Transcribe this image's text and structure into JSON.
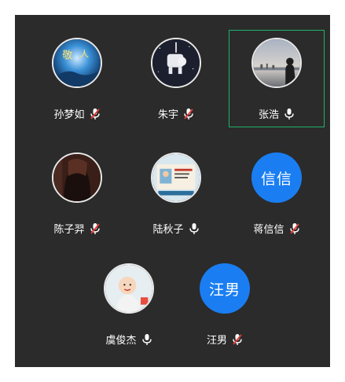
{
  "participants": [
    {
      "name": "孙梦如",
      "mic": "muted",
      "avatar": "photo"
    },
    {
      "name": "朱宇",
      "mic": "muted",
      "avatar": "photo"
    },
    {
      "name": "张浩",
      "mic": "on",
      "avatar": "photo",
      "active_speaker": true
    },
    {
      "name": "陈子羿",
      "mic": "muted",
      "avatar": "photo"
    },
    {
      "name": "陆秋子",
      "mic": "on",
      "avatar": "photo"
    },
    {
      "name": "蒋信信",
      "mic": "muted",
      "avatar": "initials",
      "initials": "信信",
      "avatar_color": "#1a7ef2"
    },
    {
      "name": "虞俊杰",
      "mic": "on",
      "avatar": "photo"
    },
    {
      "name": "汪男",
      "mic": "muted",
      "avatar": "initials",
      "initials": "汪男",
      "avatar_color": "#1a7ef2"
    }
  ],
  "colors": {
    "background": "#2b2b2b",
    "active_border": "#1fb36b",
    "muted_slash": "#e53935",
    "mic": "#ffffff"
  }
}
